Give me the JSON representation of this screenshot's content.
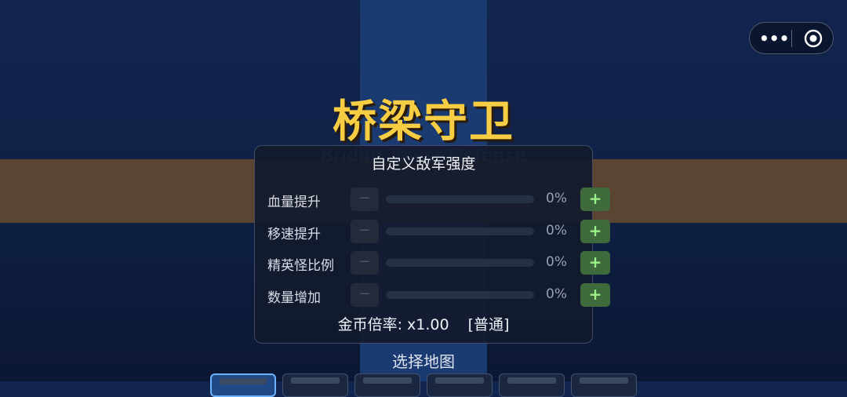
{
  "game": {
    "title": "桥梁守卫",
    "subtitle": "Bridge Tower Defense"
  },
  "menu_capsule": {
    "more_icon": "•••",
    "close_icon": "target-circle-icon"
  },
  "difficulty_panel": {
    "title": "自定义敌军强度",
    "minus_label": "−",
    "plus_label": "+",
    "rows": [
      {
        "label": "血量提升",
        "value": 0,
        "value_text": "0%"
      },
      {
        "label": "移速提升",
        "value": 0,
        "value_text": "0%"
      },
      {
        "label": "精英怪比例",
        "value": 0,
        "value_text": "0%"
      },
      {
        "label": "数量增加",
        "value": 0,
        "value_text": "0%"
      }
    ],
    "gold_rate_label": "金币倍率: x1.00",
    "difficulty_tag": "[普通]"
  },
  "map_select": {
    "label": "选择地图",
    "maps_visible": 6,
    "selected_index": 0
  },
  "colors": {
    "title_gold": "#f6cd43",
    "plus_green": "#3e6a3c",
    "bridge_blue": "#1a3a72",
    "bridge_brown": "#5b4431"
  }
}
